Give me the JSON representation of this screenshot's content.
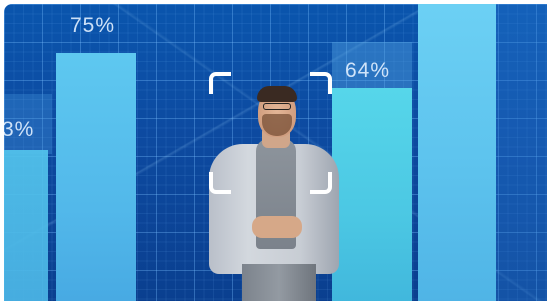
{
  "image": {
    "chart_labels": {
      "left": "3%",
      "middle_left": "75%",
      "middle_right": "64%"
    },
    "colors": {
      "background": "#0a55ad",
      "bar_light": "#5ec8f0",
      "bar_cyan": "#4bc7e3",
      "focus_frame": "#ffffff"
    },
    "icons": [
      "focus-frame-corner"
    ]
  }
}
